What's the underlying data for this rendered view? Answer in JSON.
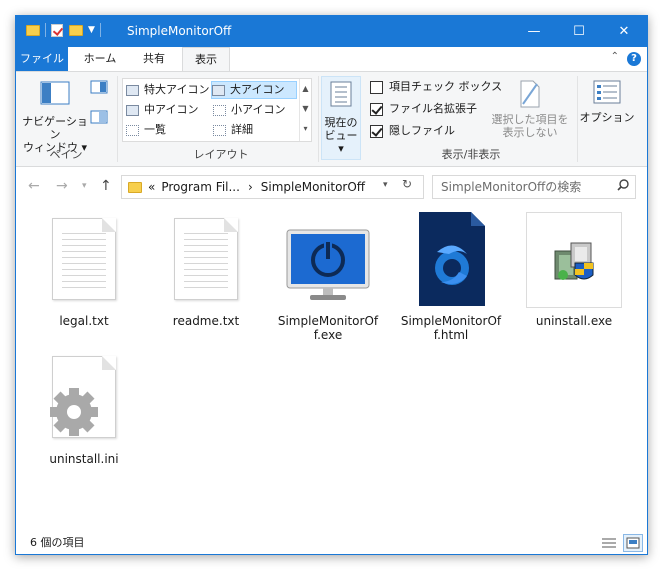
{
  "window": {
    "title": "SimpleMonitorOff"
  },
  "titlebar": {
    "minimize": "—",
    "maximize": "☐",
    "close": "✕"
  },
  "tabs": [
    {
      "label": "ファイル"
    },
    {
      "label": "ホーム"
    },
    {
      "label": "共有"
    },
    {
      "label": "表示"
    }
  ],
  "ribbon": {
    "pane": {
      "button": "ナビゲーション",
      "button2": "ウィンドウ ▾",
      "group": "ペイン"
    },
    "layout": {
      "group": "レイアウト",
      "items": [
        {
          "label": "特大アイコン"
        },
        {
          "label": "大アイコン"
        },
        {
          "label": "中アイコン"
        },
        {
          "label": "小アイコン"
        },
        {
          "label": "一覧"
        },
        {
          "label": "詳細"
        }
      ]
    },
    "current_view": {
      "line1": "現在の",
      "line2": "ビュー ▾"
    },
    "showhide": {
      "group": "表示/非表示",
      "checks": [
        {
          "label": "項目チェック ボックス",
          "checked": false
        },
        {
          "label": "ファイル名拡張子",
          "checked": true
        },
        {
          "label": "隠しファイル",
          "checked": true
        }
      ],
      "hide_selected_1": "選択した項目を",
      "hide_selected_2": "表示しない"
    },
    "options": {
      "label": "オプション"
    }
  },
  "address": {
    "prefix": "«",
    "crumb1": "Program Fil...",
    "sep": "›",
    "crumb2": "SimpleMonitorOff",
    "search_placeholder": "SimpleMonitorOffの検索"
  },
  "files": [
    {
      "name": "legal.txt",
      "type": "text"
    },
    {
      "name": "readme.txt",
      "type": "text"
    },
    {
      "name": "SimpleMonitorOf",
      "name2": "f.exe",
      "type": "exe-monitor"
    },
    {
      "name": "SimpleMonitorOf",
      "name2": "f.html",
      "type": "html"
    },
    {
      "name": "uninstall.exe",
      "type": "installer"
    },
    {
      "name": "uninstall.ini",
      "type": "ini"
    }
  ],
  "status": {
    "count": "6 個の項目"
  },
  "colors": {
    "accent": "#1a78d6",
    "ribbon_bg": "#f5f6f7",
    "selection": "#cce8ff"
  }
}
